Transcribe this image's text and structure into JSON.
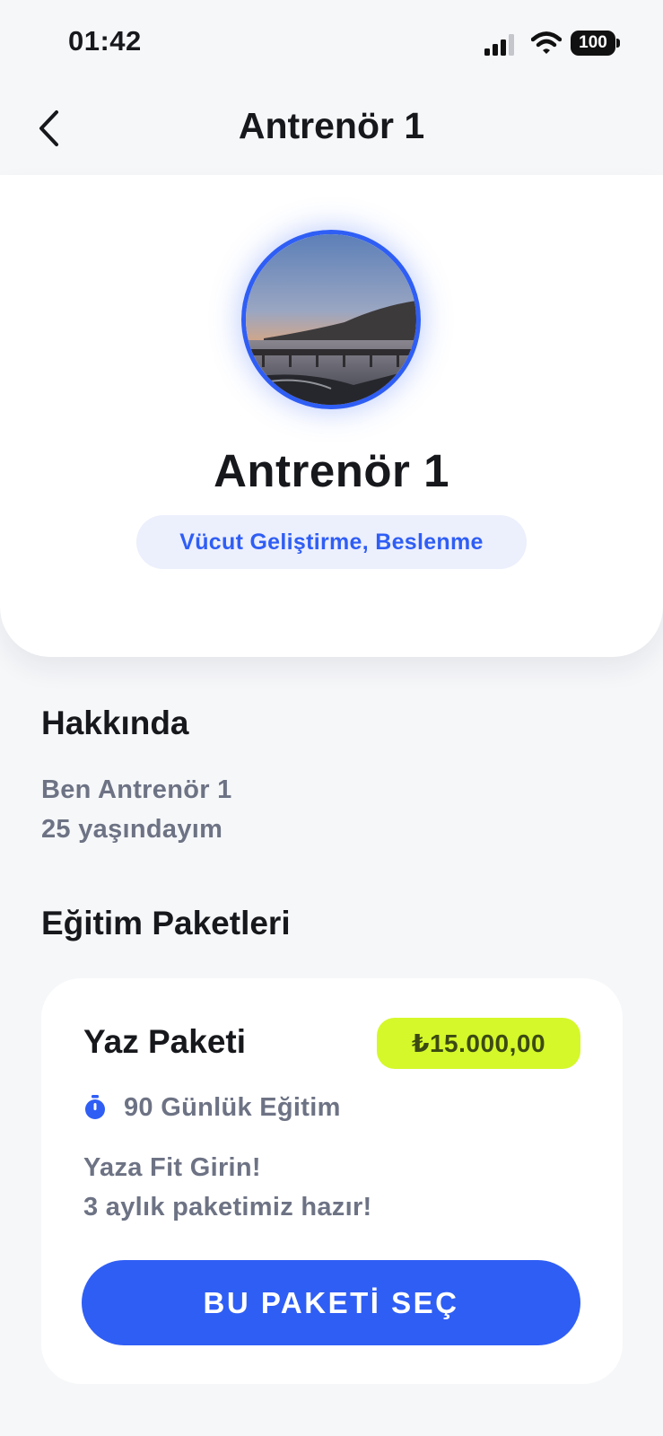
{
  "status_bar": {
    "time": "01:42",
    "battery_level": "100"
  },
  "header": {
    "back_icon": "chevron-left-icon",
    "title": "Antrenör 1"
  },
  "profile": {
    "name": "Antrenör 1",
    "specialties": "Vücut Geliştirme, Beslenme",
    "avatar_image": "sunset-pier-photo"
  },
  "about": {
    "heading": "Hakkında",
    "lines": [
      "Ben Antrenör 1",
      "25 yaşındayım"
    ]
  },
  "packages": {
    "heading": "Eğitim Paketleri",
    "items": [
      {
        "name": "Yaz Paketi",
        "price": "₺15.000,00",
        "duration_icon": "timer-icon",
        "duration": "90 Günlük Eğitim",
        "description_lines": [
          "Yaza Fit Girin!",
          "3 aylık paketimiz hazır!"
        ],
        "button_label": "BU PAKETİ SEÇ"
      }
    ]
  },
  "colors": {
    "accent": "#2f5ef5",
    "price_badge": "#d4f82a",
    "badge_bg": "#eceffc",
    "muted_text": "#6d7384",
    "background": "#f6f7f9"
  }
}
